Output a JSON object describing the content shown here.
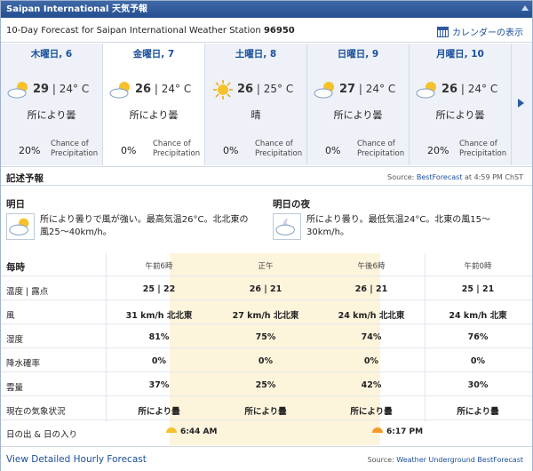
{
  "window_title": "Saipan International 天気予報",
  "header": {
    "title_prefix": "10-Day Forecast for Saipan International Weather Station ",
    "station_id": "96950",
    "calendar_label": "カレンダーの表示"
  },
  "days": [
    {
      "label": "木曜日, 6",
      "high": "29",
      "low": "| 24° C",
      "condition": "所により曇",
      "precip": "20%",
      "icon": "partly-cloudy-icon"
    },
    {
      "label": "金曜日, 7",
      "high": "26",
      "low": "| 24° C",
      "condition": "所により曇",
      "precip": "0%",
      "icon": "partly-cloudy-icon"
    },
    {
      "label": "土曜日, 8",
      "high": "26",
      "low": "| 25° C",
      "condition": "晴",
      "precip": "0%",
      "icon": "sunny-icon"
    },
    {
      "label": "日曜日, 9",
      "high": "27",
      "low": "| 24° C",
      "condition": "所により曇",
      "precip": "0%",
      "icon": "partly-cloudy-icon"
    },
    {
      "label": "月曜日, 10",
      "high": "26",
      "low": "| 24° C",
      "condition": "所により曇",
      "precip": "20%",
      "icon": "partly-cloudy-icon"
    }
  ],
  "chance_label_1": "Chance of",
  "chance_label_2": "Precipitation",
  "description": {
    "heading": "記述予報",
    "source_prefix": "Source: ",
    "source_name": "BestForecast",
    "source_time": " at 4:59 PM ChST",
    "today_title": "明日",
    "today_text": "所により曇りで風が強い。最高気温26°C。北北東の風25〜40km/h。",
    "night_title": "明日の夜",
    "night_text": "所により曇り。最低気温24°C。北東の風15〜30km/h。"
  },
  "hourly": {
    "row_header": "毎時",
    "times": [
      "午前6時",
      "正午",
      "午後6時",
      "午前0時"
    ],
    "rows": [
      {
        "label": "温度 | 露点",
        "values": [
          "25 | 22",
          "26 | 21",
          "26 | 21",
          "25 | 21"
        ]
      },
      {
        "label": "風",
        "values": [
          "31 km/h 北北東",
          "27 km/h 北北東",
          "24 km/h 北北東",
          "24 km/h 北東"
        ]
      },
      {
        "label": "湿度",
        "values": [
          "81%",
          "75%",
          "74%",
          "76%"
        ]
      },
      {
        "label": "降水確率",
        "values": [
          "0%",
          "0%",
          "0%",
          "0%"
        ]
      },
      {
        "label": "雲量",
        "values": [
          "37%",
          "25%",
          "42%",
          "30%"
        ]
      },
      {
        "label": "現在の気象状況",
        "values": [
          "所により曇",
          "所により曇",
          "所により曇",
          "所により曇"
        ]
      }
    ],
    "sun_label": "日の出 & 日の入り",
    "sunrise": "6:44 AM",
    "sunset": "6:17 PM"
  },
  "footer": {
    "detail_link": "View Detailed Hourly Forecast",
    "source_prefix": "Source: ",
    "source_name": "Weather Underground BestForecast"
  },
  "colors": {
    "accent": "#1a4f9c",
    "title_bar": "#2f5a9a",
    "highlight_band": "#fdf4dc"
  }
}
